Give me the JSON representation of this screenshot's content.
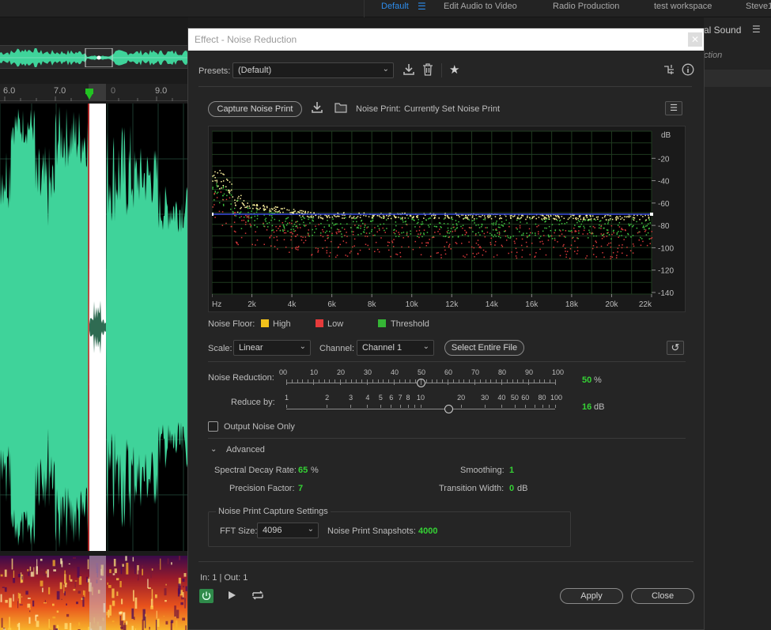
{
  "workspaces": {
    "default": "Default",
    "menu_icon": "hamburger-icon",
    "edit_audio_video": "Edit Audio to Video",
    "radio_production": "Radio Production",
    "test_workspace": "test workspace",
    "user": "Steve1"
  },
  "editor": {
    "ruler_labels": [
      "6.0",
      "7.0",
      "9.0"
    ],
    "ruler_partial": "0"
  },
  "right_panel": {
    "title": "al Sound",
    "subtitle": "ction"
  },
  "dialog": {
    "title": "Effect - Noise Reduction",
    "presets_label": "Presets:",
    "preset_value": "(Default)",
    "capture_button": "Capture Noise Print",
    "noise_print_label": "Noise Print:",
    "noise_print_value": "Currently Set Noise Print",
    "graph": {
      "db_unit": "dB",
      "db_ticks": [
        "-20",
        "-40",
        "-60",
        "-80",
        "-100",
        "-120",
        "-140"
      ],
      "hz_ticks": [
        "Hz",
        "2k",
        "4k",
        "6k",
        "8k",
        "10k",
        "12k",
        "14k",
        "16k",
        "18k",
        "20k",
        "22k"
      ]
    },
    "legend": {
      "label": "Noise Floor:",
      "high": "High",
      "low": "Low",
      "threshold": "Threshold",
      "colors": {
        "high": "#f2c21b",
        "low": "#e63b3b",
        "threshold": "#35b535"
      }
    },
    "scale_label": "Scale:",
    "scale_value": "Linear",
    "channel_label": "Channel:",
    "channel_value": "Channel 1",
    "select_entire_file": "Select Entire File",
    "noise_reduction": {
      "label": "Noise Reduction:",
      "scale": [
        "0",
        "10",
        "20",
        "30",
        "40",
        "50",
        "60",
        "70",
        "80",
        "90",
        "100"
      ],
      "value": "50",
      "unit": "%",
      "level": 0.5
    },
    "reduce_by": {
      "label": "Reduce by:",
      "scale": [
        "1",
        "2",
        "3",
        "4",
        "5",
        "6",
        "7",
        "8",
        "10",
        "20",
        "30",
        "40",
        "50",
        "60",
        "80",
        "100"
      ],
      "value": "16",
      "unit": "dB"
    },
    "output_noise_only": "Output Noise Only",
    "advanced": {
      "label": "Advanced",
      "spectral_decay_label": "Spectral Decay Rate:",
      "spectral_decay_value": "65",
      "spectral_decay_unit": "%",
      "smoothing_label": "Smoothing:",
      "smoothing_value": "1",
      "precision_label": "Precision Factor:",
      "precision_value": "7",
      "transition_label": "Transition Width:",
      "transition_value": "0",
      "transition_unit": "dB"
    },
    "capture_settings": {
      "title": "Noise Print Capture Settings",
      "fft_label": "FFT Size:",
      "fft_value": "4096",
      "snapshots_label": "Noise Print Snapshots:",
      "snapshots_value": "4000"
    },
    "io_label": "In: 1 | Out: 1",
    "apply": "Apply",
    "close": "Close"
  }
}
